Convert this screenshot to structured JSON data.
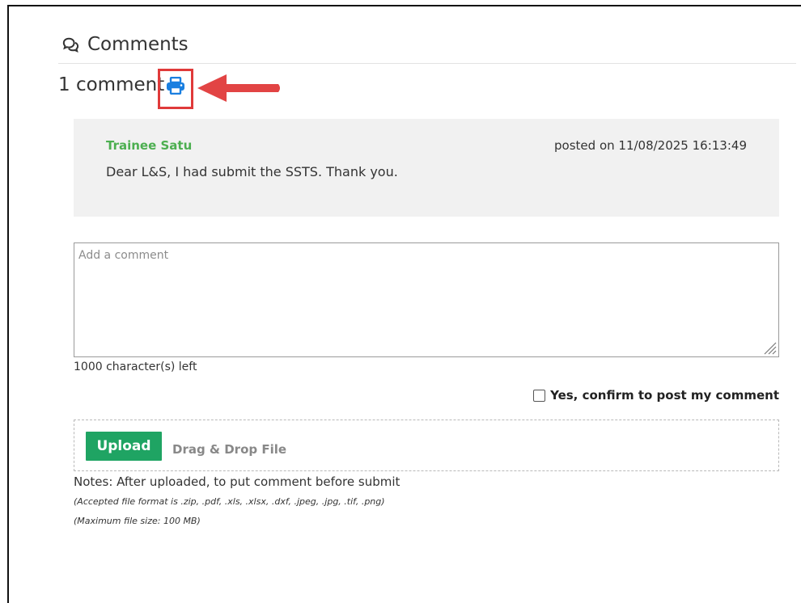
{
  "section": {
    "title": "Comments",
    "icon": "comments-icon"
  },
  "count": {
    "text": "1 comment",
    "print_icon": "print-icon",
    "annotation_color": "#e03a3a"
  },
  "comment": {
    "author": "Trainee Satu",
    "posted": "posted on 11/08/2025 16:13:49",
    "body": "Dear L&S, I had submit the SSTS. Thank you.",
    "author_color": "#4caf50"
  },
  "form": {
    "placeholder": "Add a comment",
    "value": "",
    "chars_left": "1000 character(s) left",
    "confirm_label": "Yes, confirm to post my comment",
    "confirm_checked": false
  },
  "upload": {
    "button_label": "Upload",
    "drag_text": "Drag & Drop File",
    "button_color": "#1fa463"
  },
  "notes": {
    "main": "Notes: After uploaded, to put comment before submit",
    "formats": "(Accepted file format is .zip, .pdf, .xls, .xlsx, .dxf, .jpeg, .jpg, .tif, .png)",
    "max_size": "(Maximum file size: 100 MB)"
  }
}
